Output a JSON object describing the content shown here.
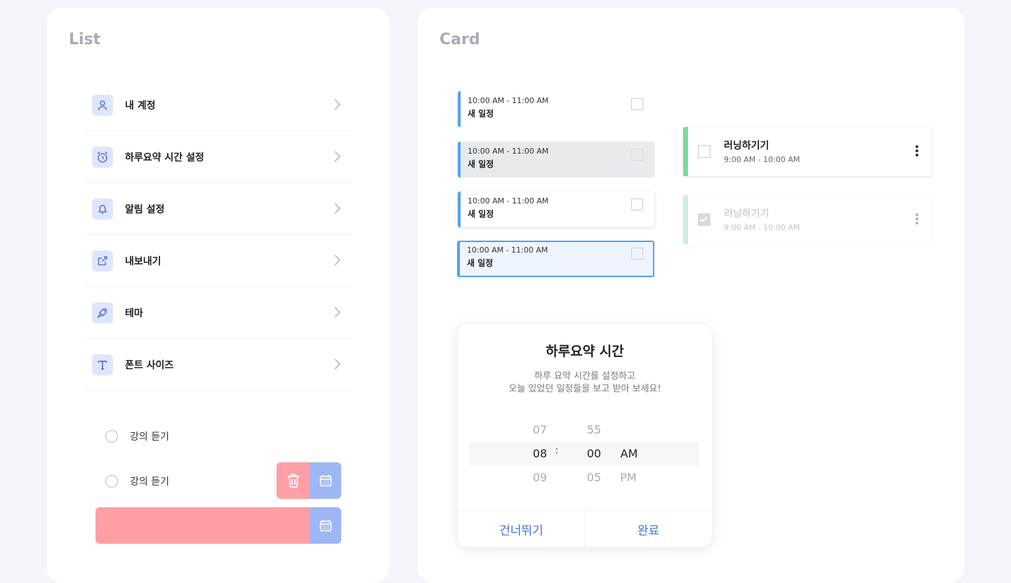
{
  "list_panel": {
    "title": "List",
    "menu": [
      {
        "label": "내 계정",
        "icon": "user-icon"
      },
      {
        "label": "하루요약 시간 설정",
        "icon": "alarm-clock-icon"
      },
      {
        "label": "알림 설정",
        "icon": "bell-icon"
      },
      {
        "label": "내보내기",
        "icon": "external-link-icon"
      },
      {
        "label": "테마",
        "icon": "paint-brush-icon"
      },
      {
        "label": "폰트 사이즈",
        "icon": "font-size-icon"
      }
    ],
    "todos": [
      {
        "label": "강의 듣기"
      },
      {
        "label": "강의 듣기"
      }
    ],
    "colors": {
      "icon_bg": "#dfe6fb",
      "icon_fg": "#5d79d9",
      "delete": "#ff9fa5",
      "calendar": "#9fb6f5"
    }
  },
  "card_panel": {
    "title": "Card",
    "schedules": [
      {
        "time": "10:00 AM - 11:00 AM",
        "title": "새 일정",
        "state": "default"
      },
      {
        "time": "10:00 AM - 11:00 AM",
        "title": "새 일정",
        "state": "pressed"
      },
      {
        "time": "10:00 AM - 11:00 AM",
        "title": "새 일정",
        "state": "raised"
      },
      {
        "time": "10:00 AM - 11:00 AM",
        "title": "새 일정",
        "state": "selected"
      }
    ],
    "tasks": [
      {
        "title": "러닝하기기",
        "time": "9:00 AM - 10:00 AM",
        "done": false
      },
      {
        "title": "러닝하기기",
        "time": "9:00 AM - 10:00 AM",
        "done": true
      }
    ],
    "dialog": {
      "title": "하루요약 시간",
      "desc_line1": "하루 요약 시간를 설정하고",
      "desc_line2": "오늘 있었던 일정들을 보고 받아 보세요!",
      "hours": [
        "07",
        "08",
        "09"
      ],
      "minutes": [
        "55",
        "00",
        "05"
      ],
      "separator": ":",
      "ampm": [
        "AM",
        "PM"
      ],
      "skip_label": "건너뛰기",
      "done_label": "완료"
    }
  }
}
